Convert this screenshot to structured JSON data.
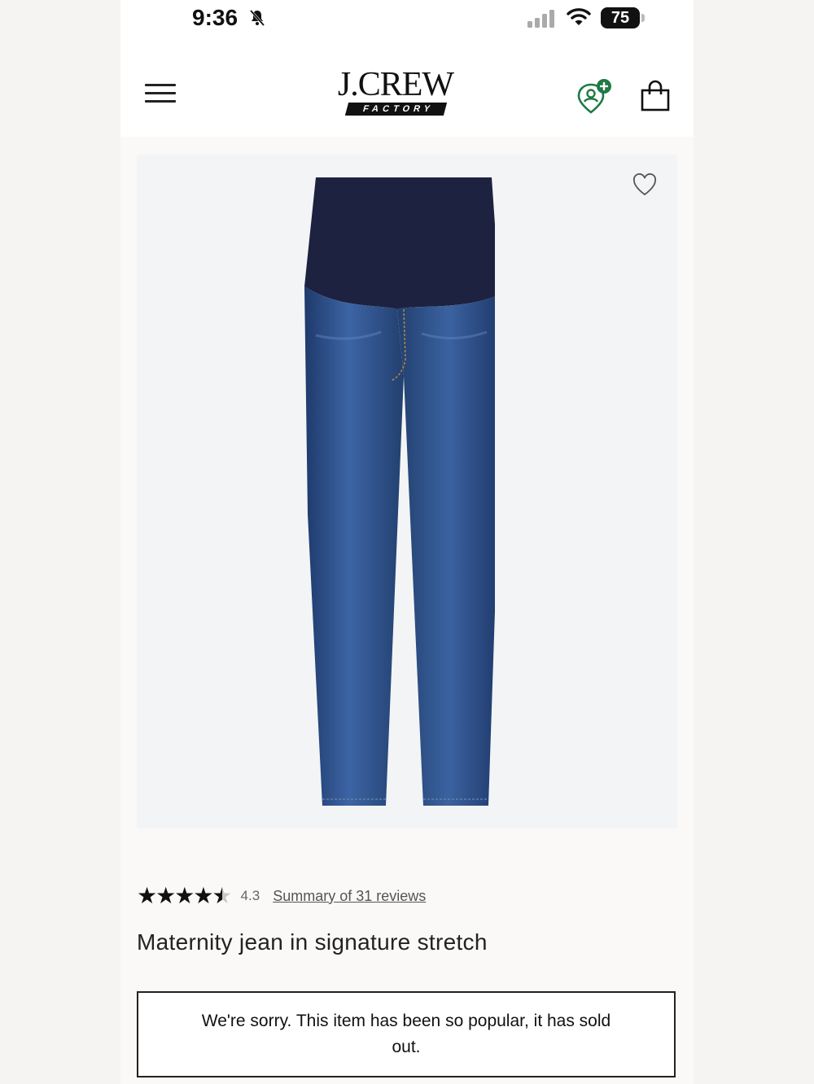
{
  "status_bar": {
    "time": "9:36",
    "battery": "75"
  },
  "header": {
    "logo_main": "J.CREW",
    "logo_sub": "FACTORY"
  },
  "product": {
    "rating_value": "4.3",
    "rating": 4.3,
    "reviews_link": "Summary of 31 reviews",
    "title": "Maternity jean in signature stretch",
    "sold_out_message": "We're sorry. This item has been so popular, it has sold out."
  },
  "icons": [
    "menu-icon",
    "account-icon",
    "bag-icon",
    "heart-icon"
  ],
  "colors": {
    "denim": "#2a4a80",
    "waistband": "#1d2240",
    "account_badge": "#1f7a45"
  }
}
